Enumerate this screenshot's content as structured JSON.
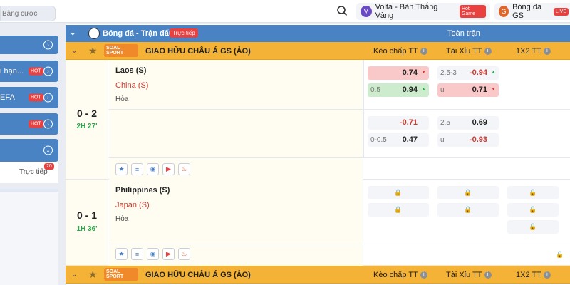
{
  "topbar": {
    "search_placeholder": "Bảng cược",
    "chip_volta": "Volta - Bàn Thắng Vàng",
    "chip_volta_badge": "Hot Game",
    "chip_bd": "Bóng đá GS",
    "chip_bd_badge": "LIVE"
  },
  "sidebar": {
    "items": [
      {
        "label": ""
      },
      {
        "label": "i hạn...",
        "badge": "HOT"
      },
      {
        "label": "EFA",
        "badge": "HOT"
      },
      {
        "label": "",
        "badge": "HOT"
      },
      {
        "label": ""
      }
    ],
    "live_label": "Trực tiếp",
    "live_count": "20"
  },
  "header": {
    "title": "Bóng đá - Trận đấu",
    "live_badge": "Trực tiếp",
    "full_match": "Toàn trận"
  },
  "leagues": [
    {
      "name": "GIAO HỮU CHÂU Á GS (ẢO)",
      "logo": "SOAL SPORT",
      "col1": "Kèo chấp TT",
      "col2": "Tài Xỉu TT",
      "col3": "1X2 TT"
    },
    {
      "name": "GIAO HỮU CHÂU Á GS (ẢO)",
      "logo": "SOAL SPORT",
      "col1": "Kèo chấp TT",
      "col2": "Tài Xỉu TT",
      "col3": "1X2 TT"
    }
  ],
  "matches": [
    {
      "score": "0 - 2",
      "time": "2H 27'",
      "home": "Laos (S)",
      "away": "China (S)",
      "draw": "Hòa",
      "odds": {
        "r1_hdp_home": "0.74",
        "r1_ou_line": "2.5-3",
        "r1_ou_over": "-0.94",
        "r2_hdp_line": "0.5",
        "r2_hdp_away": "0.94",
        "r2_ou_u": "u",
        "r2_ou_under": "0.71",
        "r3_hdp_home": "-0.71",
        "r3_ou_line": "2.5",
        "r3_ou_over": "0.69",
        "r4_hdp_line": "0-0.5",
        "r4_hdp_away": "0.47",
        "r4_ou_u": "u",
        "r4_ou_under": "-0.93"
      }
    },
    {
      "score": "0 - 1",
      "time": "1H 36'",
      "home": "Philippines (S)",
      "away": "Japan (S)",
      "draw": "Hòa"
    }
  ]
}
